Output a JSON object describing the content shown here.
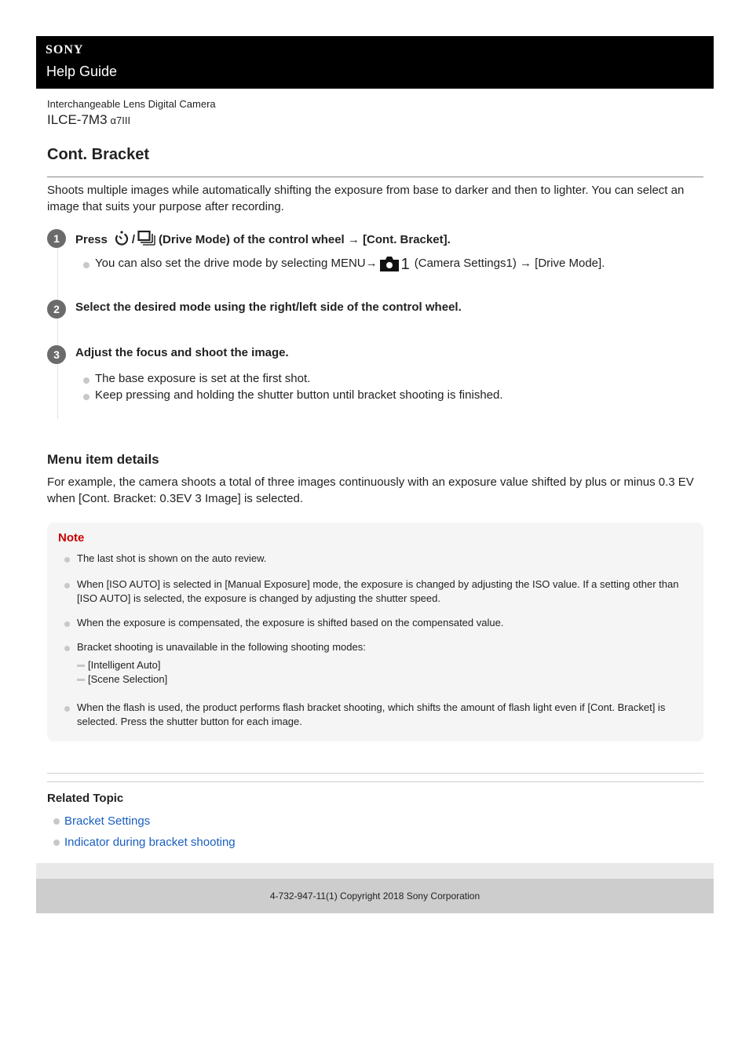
{
  "header": {
    "brand": "SONY",
    "title": "Help Guide"
  },
  "product": {
    "type": "Interchangeable Lens Digital Camera",
    "model": "ILCE-7M3",
    "alias": "α7III"
  },
  "page": {
    "title": "Cont. Bracket",
    "intro": "Shoots multiple images while automatically shifting the exposure from base to darker and then to lighter. You can select an image that suits your purpose after recording."
  },
  "steps": [
    {
      "number": "1",
      "title_prefix": "Press",
      "title_separator": "/",
      "title_suffix": "(Drive Mode) of the control wheel → [Cont. Bracket].",
      "icons": [
        "self-timer-icon",
        "drive-mode-icon"
      ],
      "bullets": [
        {
          "prefix": "You can also set the drive mode by selecting MENU→",
          "icon": "camera-settings-icon",
          "icon_label": "1",
          "suffix": "(Camera Settings1) → [Drive Mode]."
        }
      ]
    },
    {
      "number": "2",
      "title": "Select the desired mode using the right/left side of the control wheel."
    },
    {
      "number": "3",
      "title": "Adjust the focus and shoot the image.",
      "bullets": [
        "The base exposure is set at the first shot.",
        "Keep pressing and holding the shutter button until bracket shooting is finished."
      ]
    }
  ],
  "menu_details": {
    "heading": "Menu item details",
    "text": "For example, the camera shoots a total of three images continuously with an exposure value shifted by plus or minus 0.3 EV when [Cont. Bracket: 0.3EV 3 Image] is selected."
  },
  "note": {
    "title": "Note",
    "items": [
      "The last shot is shown on the auto review.",
      "When [ISO AUTO] is selected in [Manual Exposure] mode, the exposure is changed by adjusting the ISO value. If a setting other than [ISO AUTO] is selected, the exposure is changed by adjusting the shutter speed.",
      "When the exposure is compensated, the exposure is shifted based on the compensated value.",
      "Bracket shooting is unavailable in the following shooting modes:",
      "When the flash is used, the product performs flash bracket shooting, which shifts the amount of flash light even if [Cont. Bracket] is selected. Press the shutter button for each image."
    ],
    "sub_items": [
      "[Intelligent Auto]",
      "[Scene Selection]"
    ]
  },
  "related": {
    "title": "Related Topic",
    "links": [
      "Bracket Settings",
      "Indicator during bracket shooting"
    ]
  },
  "footer": {
    "text": "4-732-947-11(1) Copyright 2018 Sony Corporation"
  },
  "colors": {
    "header_bg": "#000000",
    "note_title": "#cc0000",
    "link": "#1a5fbf",
    "step_badge": "#6b6b6b"
  }
}
